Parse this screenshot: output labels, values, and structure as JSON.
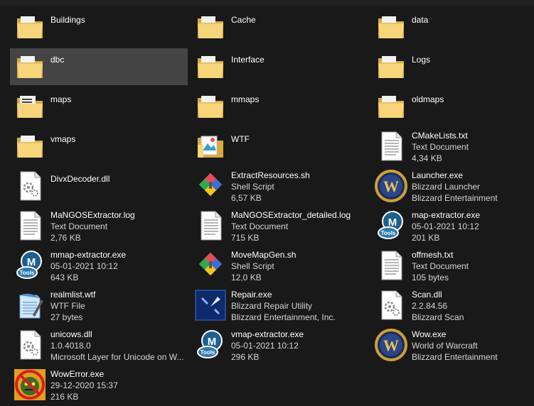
{
  "window": {
    "colors": {
      "background": "#191919",
      "selected": "#444444",
      "text": "#ffffff",
      "subtext": "#d4d4d4"
    }
  },
  "files": [
    {
      "name": "Buildings",
      "icon": "folder-icon",
      "lines": []
    },
    {
      "name": "Cache",
      "icon": "folder-icon",
      "lines": []
    },
    {
      "name": "data",
      "icon": "folder-icon",
      "lines": []
    },
    {
      "name": "dbc",
      "icon": "folder-icon",
      "lines": [],
      "selected": true
    },
    {
      "name": "Interface",
      "icon": "folder-icon",
      "lines": []
    },
    {
      "name": "Logs",
      "icon": "folder-icon",
      "lines": []
    },
    {
      "name": "maps",
      "icon": "folder-docs-icon",
      "lines": []
    },
    {
      "name": "mmaps",
      "icon": "folder-icon",
      "lines": []
    },
    {
      "name": "oldmaps",
      "icon": "folder-icon",
      "lines": []
    },
    {
      "name": "vmaps",
      "icon": "folder-icon",
      "lines": []
    },
    {
      "name": "WTF",
      "icon": "folder-image-icon",
      "lines": []
    },
    {
      "name": "CMakeLists.txt",
      "icon": "text-document-icon",
      "lines": [
        "Text Document",
        "4,34 KB"
      ]
    },
    {
      "name": "DivxDecoder.dll",
      "icon": "dll-icon",
      "lines": []
    },
    {
      "name": "ExtractResources.sh",
      "icon": "shell-script-icon",
      "lines": [
        "Shell Script",
        "6,57 KB"
      ]
    },
    {
      "name": "Launcher.exe",
      "icon": "wow-icon",
      "lines": [
        "Blizzard Launcher",
        "Blizzard Entertainment"
      ]
    },
    {
      "name": "MaNGOSExtractor.log",
      "icon": "text-document-icon",
      "lines": [
        "Text Document",
        "2,76 KB"
      ]
    },
    {
      "name": "MaNGOSExtractor_detailed.log",
      "icon": "text-document-icon",
      "lines": [
        "Text Document",
        "715 KB"
      ]
    },
    {
      "name": "map-extractor.exe",
      "icon": "mangos-tools-icon",
      "lines": [
        "05-01-2021 10:12",
        "201 KB"
      ]
    },
    {
      "name": "mmap-extractor.exe",
      "icon": "mangos-tools-icon",
      "lines": [
        "05-01-2021 10:12",
        "643 KB"
      ]
    },
    {
      "name": "MoveMapGen.sh",
      "icon": "shell-script-icon",
      "lines": [
        "Shell Script",
        "12,0 KB"
      ]
    },
    {
      "name": "offmesh.txt",
      "icon": "text-document-icon",
      "lines": [
        "Text Document",
        "105 bytes"
      ]
    },
    {
      "name": "realmlist.wtf",
      "icon": "notepad-icon",
      "lines": [
        "WTF File",
        "27 bytes"
      ]
    },
    {
      "name": "Repair.exe",
      "icon": "repair-icon",
      "lines": [
        "Blizzard Repair Utility",
        "Blizzard Entertainment, Inc."
      ]
    },
    {
      "name": "Scan.dll",
      "icon": "dll-icon",
      "lines": [
        "2.2.84.56",
        "Blizzard Scan"
      ]
    },
    {
      "name": "unicows.dll",
      "icon": "dll-icon",
      "lines": [
        "1.0.4018.0",
        "Microsoft Layer for Unicode on W..."
      ]
    },
    {
      "name": "vmap-extractor.exe",
      "icon": "mangos-tools-icon",
      "lines": [
        "05-01-2021 10:12",
        "296 KB"
      ]
    },
    {
      "name": "Wow.exe",
      "icon": "wow-icon",
      "lines": [
        "World of Warcraft",
        "Blizzard Entertainment"
      ]
    },
    {
      "name": "WowError.exe",
      "icon": "wow-error-icon",
      "lines": [
        "29-12-2020 15:37",
        "216 KB"
      ]
    }
  ]
}
